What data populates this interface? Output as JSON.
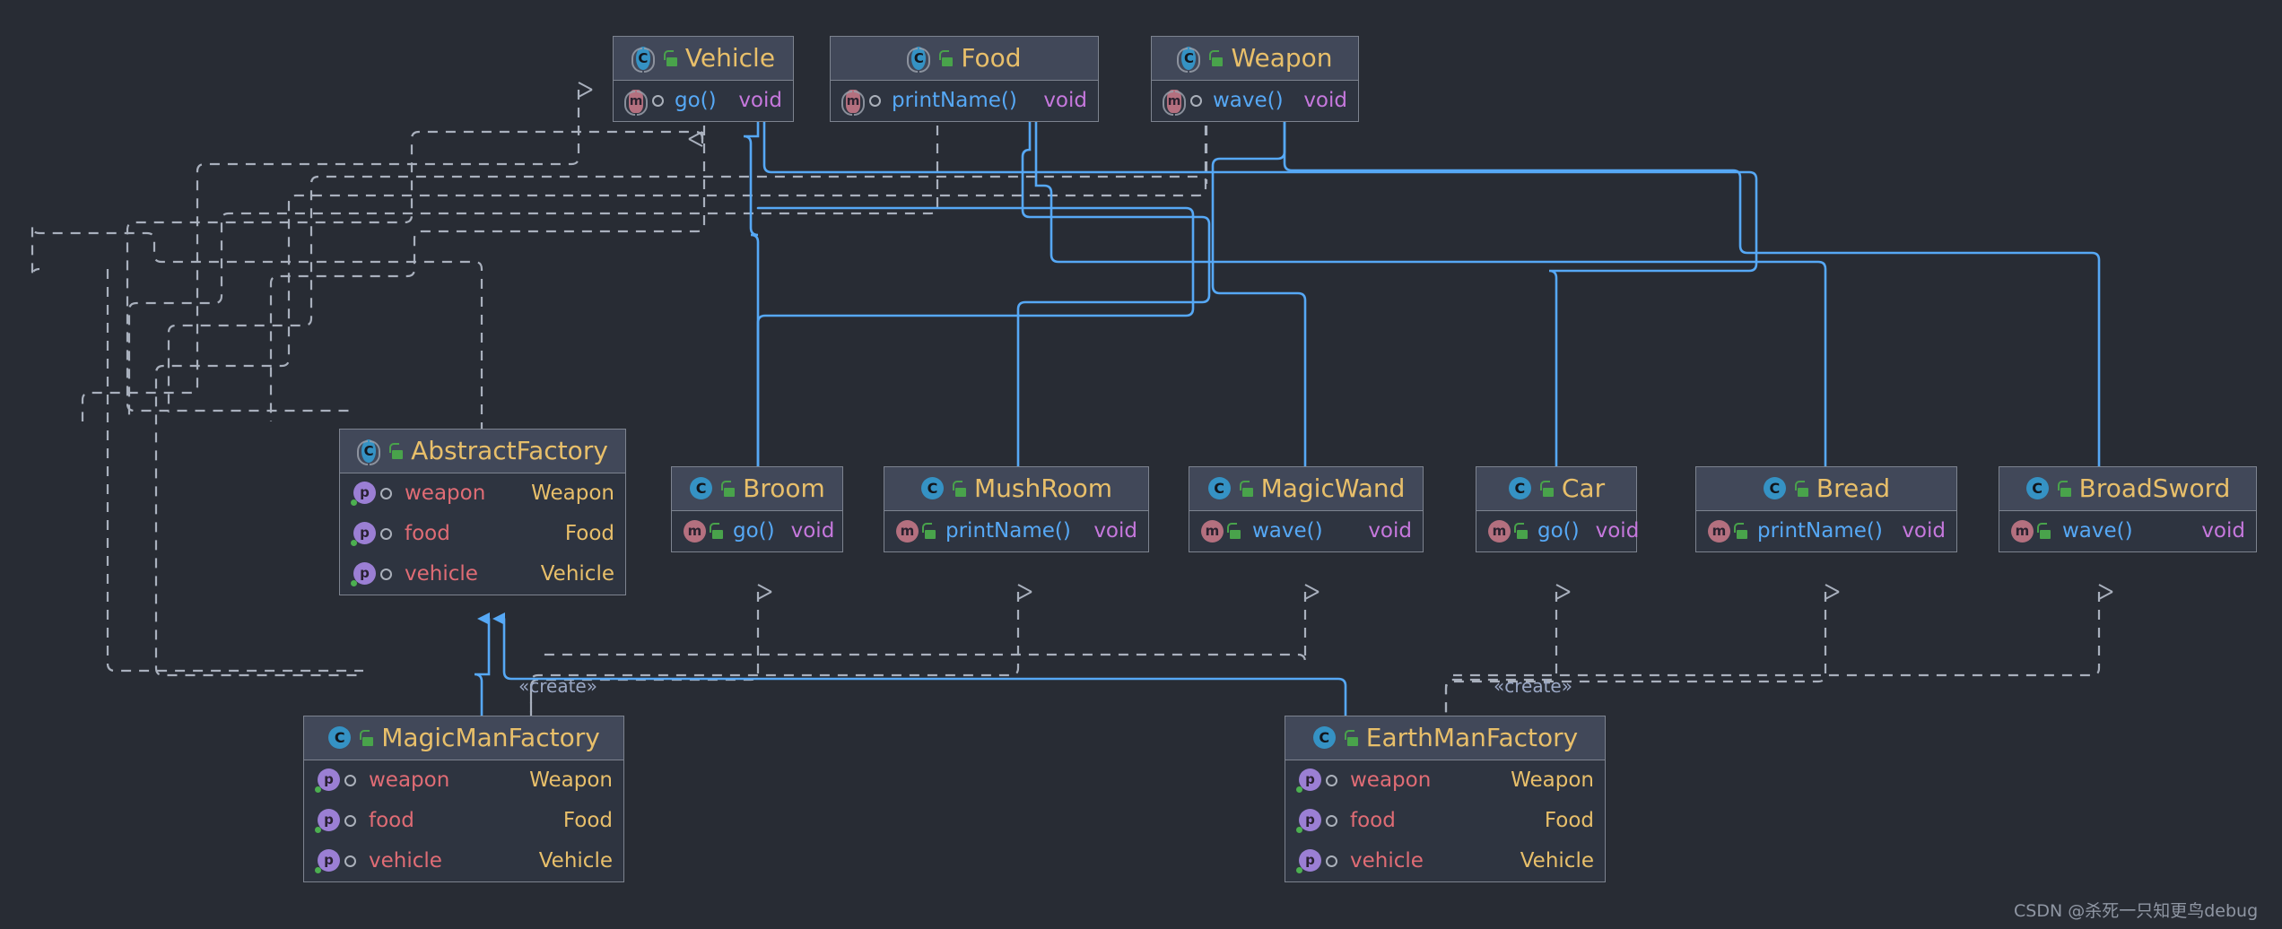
{
  "diagram": {
    "title": "Abstract Factory UML class diagram",
    "background_color": "#282c34",
    "node_header_color": "#414859",
    "node_body_color": "#2e3440",
    "node_border_color": "#7d838f",
    "realization_color": "#56a8f5",
    "dependency_color": "#a9b0bd",
    "class_name_color": "#e8bf6a",
    "method_name_color": "#56a8f5",
    "field_name_color": "#e06c75",
    "void_type_color": "#c678dd"
  },
  "nodes": {
    "vehicle": {
      "name": "Vehicle",
      "kind": "interface",
      "type_icon": "interface-icon",
      "visibility_icon": "public-unlock-icon",
      "members": [
        {
          "marker": "abstract-method-icon",
          "vis_icon": "hollow-circle-icon",
          "name": "go()",
          "type": "void",
          "kind": "method"
        }
      ]
    },
    "food": {
      "name": "Food",
      "kind": "interface",
      "type_icon": "interface-icon",
      "visibility_icon": "public-unlock-icon",
      "members": [
        {
          "marker": "abstract-method-icon",
          "vis_icon": "hollow-circle-icon",
          "name": "printName()",
          "type": "void",
          "kind": "method"
        }
      ]
    },
    "weapon": {
      "name": "Weapon",
      "kind": "interface",
      "type_icon": "interface-icon",
      "visibility_icon": "public-unlock-icon",
      "members": [
        {
          "marker": "abstract-method-icon",
          "vis_icon": "hollow-circle-icon",
          "name": "wave()",
          "type": "void",
          "kind": "method"
        }
      ]
    },
    "abstract_factory": {
      "name": "AbstractFactory",
      "kind": "interface",
      "type_icon": "interface-icon",
      "visibility_icon": "public-unlock-icon",
      "members": [
        {
          "marker": "property-icon",
          "vis_icon": "hollow-circle-icon",
          "name": "weapon",
          "type": "Weapon",
          "kind": "field"
        },
        {
          "marker": "property-icon",
          "vis_icon": "hollow-circle-icon",
          "name": "food",
          "type": "Food",
          "kind": "field"
        },
        {
          "marker": "property-icon",
          "vis_icon": "hollow-circle-icon",
          "name": "vehicle",
          "type": "Vehicle",
          "kind": "field"
        }
      ]
    },
    "broom": {
      "name": "Broom",
      "kind": "class",
      "type_icon": "class-icon",
      "visibility_icon": "public-unlock-icon",
      "members": [
        {
          "marker": "method-icon",
          "vis_icon": "public-unlock-icon",
          "name": "go()",
          "type": "void",
          "kind": "method"
        }
      ]
    },
    "mushroom": {
      "name": "MushRoom",
      "kind": "class",
      "type_icon": "class-icon",
      "visibility_icon": "public-unlock-icon",
      "members": [
        {
          "marker": "method-icon",
          "vis_icon": "public-unlock-icon",
          "name": "printName()",
          "type": "void",
          "kind": "method"
        }
      ]
    },
    "magicwand": {
      "name": "MagicWand",
      "kind": "class",
      "type_icon": "class-icon",
      "visibility_icon": "public-unlock-icon",
      "members": [
        {
          "marker": "method-icon",
          "vis_icon": "public-unlock-icon",
          "name": "wave()",
          "type": "void",
          "kind": "method"
        }
      ]
    },
    "car": {
      "name": "Car",
      "kind": "class",
      "type_icon": "class-icon",
      "visibility_icon": "public-unlock-icon",
      "members": [
        {
          "marker": "method-icon",
          "vis_icon": "public-unlock-icon",
          "name": "go()",
          "type": "void",
          "kind": "method"
        }
      ]
    },
    "bread": {
      "name": "Bread",
      "kind": "class",
      "type_icon": "class-icon",
      "visibility_icon": "public-unlock-icon",
      "members": [
        {
          "marker": "method-icon",
          "vis_icon": "public-unlock-icon",
          "name": "printName()",
          "type": "void",
          "kind": "method"
        }
      ]
    },
    "broadsword": {
      "name": "BroadSword",
      "kind": "class",
      "type_icon": "class-icon",
      "visibility_icon": "public-unlock-icon",
      "members": [
        {
          "marker": "method-icon",
          "vis_icon": "public-unlock-icon",
          "name": "wave()",
          "type": "void",
          "kind": "method"
        }
      ]
    },
    "magicmanfactory": {
      "name": "MagicManFactory",
      "kind": "class",
      "type_icon": "class-icon",
      "visibility_icon": "public-unlock-icon",
      "members": [
        {
          "marker": "property-icon",
          "vis_icon": "hollow-circle-icon",
          "name": "weapon",
          "type": "Weapon",
          "kind": "field"
        },
        {
          "marker": "property-icon",
          "vis_icon": "hollow-circle-icon",
          "name": "food",
          "type": "Food",
          "kind": "field"
        },
        {
          "marker": "property-icon",
          "vis_icon": "hollow-circle-icon",
          "name": "vehicle",
          "type": "Vehicle",
          "kind": "field"
        }
      ]
    },
    "earthmanfactory": {
      "name": "EarthManFactory",
      "kind": "class",
      "type_icon": "class-icon",
      "visibility_icon": "public-unlock-icon",
      "members": [
        {
          "marker": "property-icon",
          "vis_icon": "hollow-circle-icon",
          "name": "weapon",
          "type": "Weapon",
          "kind": "field"
        },
        {
          "marker": "property-icon",
          "vis_icon": "hollow-circle-icon",
          "name": "food",
          "type": "Food",
          "kind": "field"
        },
        {
          "marker": "property-icon",
          "vis_icon": "hollow-circle-icon",
          "name": "vehicle",
          "type": "Vehicle",
          "kind": "field"
        }
      ]
    }
  },
  "edge_labels": {
    "create_left": "«create»",
    "create_right": "«create»"
  },
  "watermark": {
    "text": "CSDN @杀死一只知更鸟debug"
  }
}
